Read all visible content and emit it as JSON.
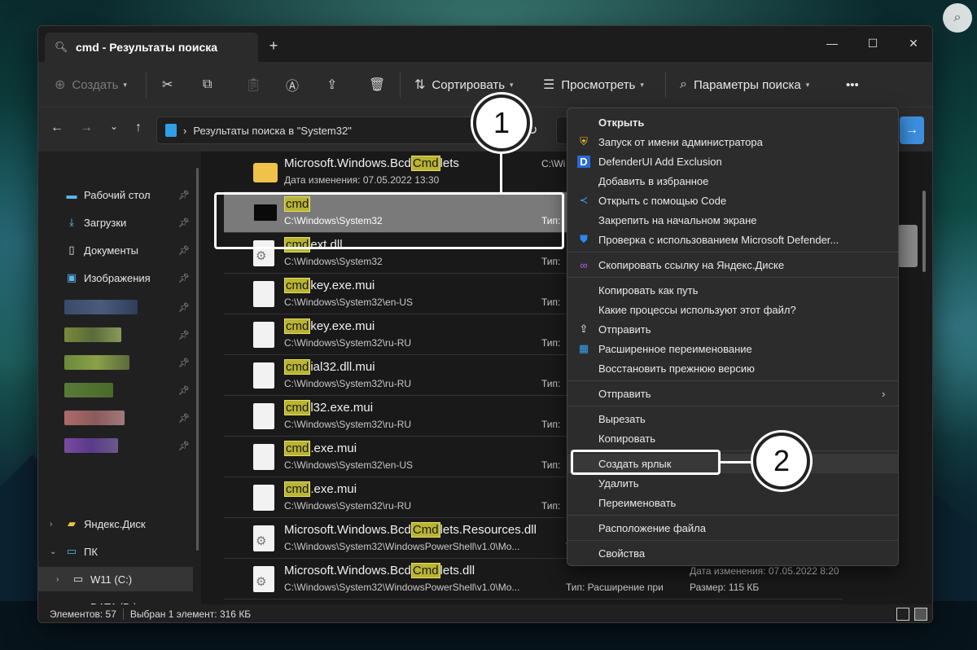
{
  "window": {
    "tab_title": "cmd - Результаты поиска",
    "new_tab": "+",
    "minimize": "—",
    "maximize": "☐",
    "close": "✕"
  },
  "toolbar": {
    "create_label": "Создать",
    "sort_label": "Сортировать",
    "view_label": "Просмотреть",
    "search_params_label": "Параметры поиска",
    "more_label": "•••"
  },
  "navigation": {
    "address": "Результаты поиска в \"System32\""
  },
  "sidebar": {
    "items": [
      {
        "label": "Рабочий стол"
      },
      {
        "label": "Загрузки"
      },
      {
        "label": "Документы"
      },
      {
        "label": "Изображения"
      }
    ],
    "yandex_disk": "Яндекс.Диск",
    "pc": "ПК",
    "drive_c": "W11 (C:)",
    "drive_d": "DATA (D:)"
  },
  "files": [
    {
      "prefix": "Microsoft.Windows.Bcd",
      "match": "Cmd",
      "suffix": "lets",
      "path": "Дата изменения: 07.05.2022 13:30",
      "type": "C:\\Wi",
      "icon": "folder"
    },
    {
      "prefix": "",
      "match": "cmd",
      "suffix": "",
      "path": "C:\\Windows\\System32",
      "type": "Тип:",
      "icon": "cmd"
    },
    {
      "prefix": "",
      "match": "cmd",
      "suffix": "ext.dll",
      "path": "C:\\Windows\\System32",
      "type": "Тип:",
      "icon": "gear"
    },
    {
      "prefix": "",
      "match": "cmd",
      "suffix": "key.exe.mui",
      "path": "C:\\Windows\\System32\\en-US",
      "type": "Тип:",
      "icon": "doc"
    },
    {
      "prefix": "",
      "match": "cmd",
      "suffix": "key.exe.mui",
      "path": "C:\\Windows\\System32\\ru-RU",
      "type": "Тип:",
      "icon": "doc"
    },
    {
      "prefix": "",
      "match": "cmd",
      "suffix": "ial32.dll.mui",
      "path": "C:\\Windows\\System32\\ru-RU",
      "type": "Тип:",
      "icon": "doc"
    },
    {
      "prefix": "",
      "match": "cmd",
      "suffix": "l32.exe.mui",
      "path": "C:\\Windows\\System32\\ru-RU",
      "type": "Тип:",
      "icon": "doc"
    },
    {
      "prefix": "",
      "match": "cmd",
      "suffix": ".exe.mui",
      "path": "C:\\Windows\\System32\\en-US",
      "type": "Тип:",
      "icon": "doc"
    },
    {
      "prefix": "",
      "match": "cmd",
      "suffix": ".exe.mui",
      "path": "C:\\Windows\\System32\\ru-RU",
      "type": "Тип:",
      "icon": "doc"
    },
    {
      "prefix": "Microsoft.Windows.Bcd",
      "match": "Cmd",
      "suffix": "lets.Resources.dll",
      "path": "C:\\Windows\\System32\\WindowsPowerShell\\v1.0\\Mo...",
      "type": "Тип:",
      "icon": "gear"
    },
    {
      "prefix": "Microsoft.Windows.Bcd",
      "match": "Cmd",
      "suffix": "lets.dll",
      "path": "C:\\Windows\\System32\\WindowsPowerShell\\v1.0\\Mo...",
      "type": "Тип: Расширение при",
      "icon": "gear"
    }
  ],
  "last_row_extra": {
    "date": "Дата изменения: 07.05.2022 8:20",
    "size": "Размер: 115 КБ"
  },
  "status": {
    "count": "Элементов: 57",
    "selected": "Выбран 1 элемент: 316 КБ"
  },
  "context_menu": {
    "items": [
      {
        "label": "Открыть"
      },
      {
        "label": "Запуск от имени администратора"
      },
      {
        "label": "DefenderUI Add Exclusion"
      },
      {
        "label": "Добавить в избранное"
      },
      {
        "label": "Открыть с помощью Code"
      },
      {
        "label": "Закрепить на начальном экране"
      },
      {
        "label": "Проверка с использованием Microsoft Defender..."
      },
      {
        "label": "Скопировать ссылку на Яндекс.Диске"
      },
      {
        "label": "Копировать как путь"
      },
      {
        "label": "Какие процессы используют этот файл?"
      },
      {
        "label": "Отправить"
      },
      {
        "label": "Расширенное переименование"
      },
      {
        "label": "Восстановить прежнюю версию"
      },
      {
        "label": "Отправить"
      },
      {
        "label": "Вырезать"
      },
      {
        "label": "Копировать"
      },
      {
        "label": "Создать ярлык"
      },
      {
        "label": "Удалить"
      },
      {
        "label": "Переименовать"
      },
      {
        "label": "Расположение файла"
      },
      {
        "label": "Свойства"
      }
    ]
  },
  "annotations": {
    "step1": "1",
    "step2": "2"
  },
  "colors": {
    "highlight": "#b9b433",
    "accent": "#3c8fe0"
  }
}
